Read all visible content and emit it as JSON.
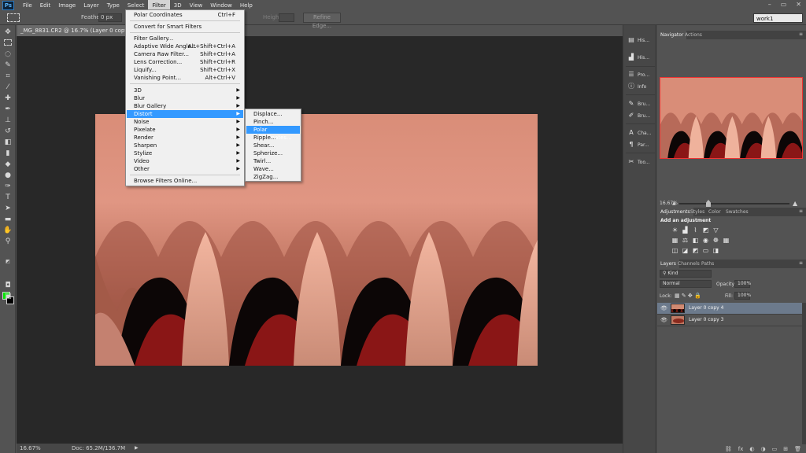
{
  "app": {
    "logo": "Ps"
  },
  "menubar": [
    "File",
    "Edit",
    "Image",
    "Layer",
    "Type",
    "Select",
    "Filter",
    "3D",
    "View",
    "Window",
    "Help"
  ],
  "window_controls": [
    "–",
    "▭",
    "✕"
  ],
  "options": {
    "feather_label": "Feather:",
    "feather_value": "0 px",
    "height_label": "Height:",
    "refine_edge": "Refine Edge...",
    "workspace": "work1"
  },
  "document_tab": "_MG_8831.CR2 @ 16.7% (Layer 0 copy 4, RGB/8*)",
  "filter_menu": {
    "last_filter": {
      "label": "Polar Coordinates",
      "shortcut": "Ctrl+F"
    },
    "convert_smart": "Convert for Smart Filters",
    "items": [
      {
        "label": "Filter Gallery...",
        "shortcut": ""
      },
      {
        "label": "Adaptive Wide Angle...",
        "shortcut": "Alt+Shift+Ctrl+A"
      },
      {
        "label": "Camera Raw Filter...",
        "shortcut": "Shift+Ctrl+A"
      },
      {
        "label": "Lens Correction...",
        "shortcut": "Shift+Ctrl+R"
      },
      {
        "label": "Liquify...",
        "shortcut": "Shift+Ctrl+X"
      },
      {
        "label": "Vanishing Point...",
        "shortcut": "Alt+Ctrl+V"
      }
    ],
    "submenus": [
      "3D",
      "Blur",
      "Blur Gallery",
      "Distort",
      "Noise",
      "Pixelate",
      "Render",
      "Sharpen",
      "Stylize",
      "Video",
      "Other"
    ],
    "browse_online": "Browse Filters Online..."
  },
  "distort_menu": [
    "Displace...",
    "Pinch...",
    "Polar Coordinates...",
    "Ripple...",
    "Shear...",
    "Spherize...",
    "Twirl...",
    "Wave...",
    "ZigZag..."
  ],
  "panel_strip": [
    {
      "icon": "history-icon",
      "label": "His..."
    },
    {
      "icon": "histogram-icon",
      "label": "His..."
    },
    {
      "icon": "properties-icon",
      "label": "Pro..."
    },
    {
      "icon": "info-icon",
      "label": "Info"
    },
    {
      "icon": "brush-icon",
      "label": "Bru..."
    },
    {
      "icon": "brush-presets-icon",
      "label": "Bru..."
    },
    {
      "icon": "character-icon",
      "label": "Cha..."
    },
    {
      "icon": "paragraph-icon",
      "label": "Par..."
    },
    {
      "icon": "tool-presets-icon",
      "label": "Too..."
    }
  ],
  "navigator": {
    "tabs": [
      "Navigator",
      "Actions"
    ],
    "zoom": "16.67%"
  },
  "adjustments": {
    "tabs": [
      "Adjustments",
      "Styles",
      "Color",
      "Swatches"
    ],
    "title": "Add an adjustment"
  },
  "layers": {
    "tabs": [
      "Layers",
      "Channels",
      "Paths"
    ],
    "kind": "Kind",
    "blend_mode": "Normal",
    "opacity_label": "Opacity:",
    "opacity_value": "100%",
    "lock_label": "Lock:",
    "fill_label": "Fill:",
    "fill_value": "100%",
    "items": [
      {
        "name": "Layer 0 copy 4",
        "selected": true
      },
      {
        "name": "Layer 0 copy 3",
        "selected": false
      }
    ],
    "footer_icons": [
      "⛓",
      "fx",
      "◐",
      "◑",
      "▭",
      "⊞",
      "🗑"
    ]
  },
  "status": {
    "zoom": "16.67%",
    "doc": "Doc: 65.2M/136.7M"
  },
  "colors": {
    "foreground": "#00e600",
    "background": "#000000",
    "highlight": "#3399ff"
  }
}
